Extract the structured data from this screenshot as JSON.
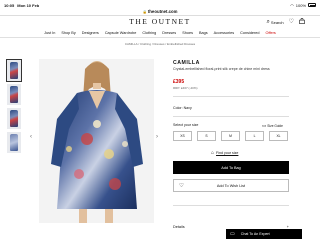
{
  "status_bar": {
    "time": "10:05",
    "date": "Mon 10 Feb",
    "battery": "100%"
  },
  "browser": {
    "url": "theoutnet.com"
  },
  "header": {
    "logo": "THE OUTNET",
    "search_label": "Search"
  },
  "nav": {
    "items": [
      "Just In",
      "Shop By",
      "Designers",
      "Capsule Wardrobe",
      "Clothing",
      "Dresses",
      "Shoes",
      "Bags",
      "Accessories",
      "Considered",
      "Offers"
    ],
    "offers_color": "#cc0000"
  },
  "breadcrumb": "CAMILLA  /  Clothing  /  Dresses  /  Embellished Dresses",
  "product": {
    "brand": "CAMILLA",
    "name": "Crystal-embellished floral-print silk crepe de chine mini dress",
    "price_sale": "£395",
    "price_rrp": "RRP: £467 (-40%)",
    "color_label": "Color: Navy",
    "size_title": "Select your size",
    "size_guide": "Size Guide",
    "sizes": [
      "XS",
      "S",
      "M",
      "L",
      "XL"
    ],
    "find_size": "Find your size",
    "add_to_bag": "Add To Bag",
    "add_to_wishlist": "Add To Wish List",
    "details": "Details",
    "details_icon": "plus-icon"
  },
  "chat": {
    "label": "Chat To An Expert"
  },
  "colors": {
    "sale_red": "#cc0000",
    "button_black": "#000000"
  }
}
